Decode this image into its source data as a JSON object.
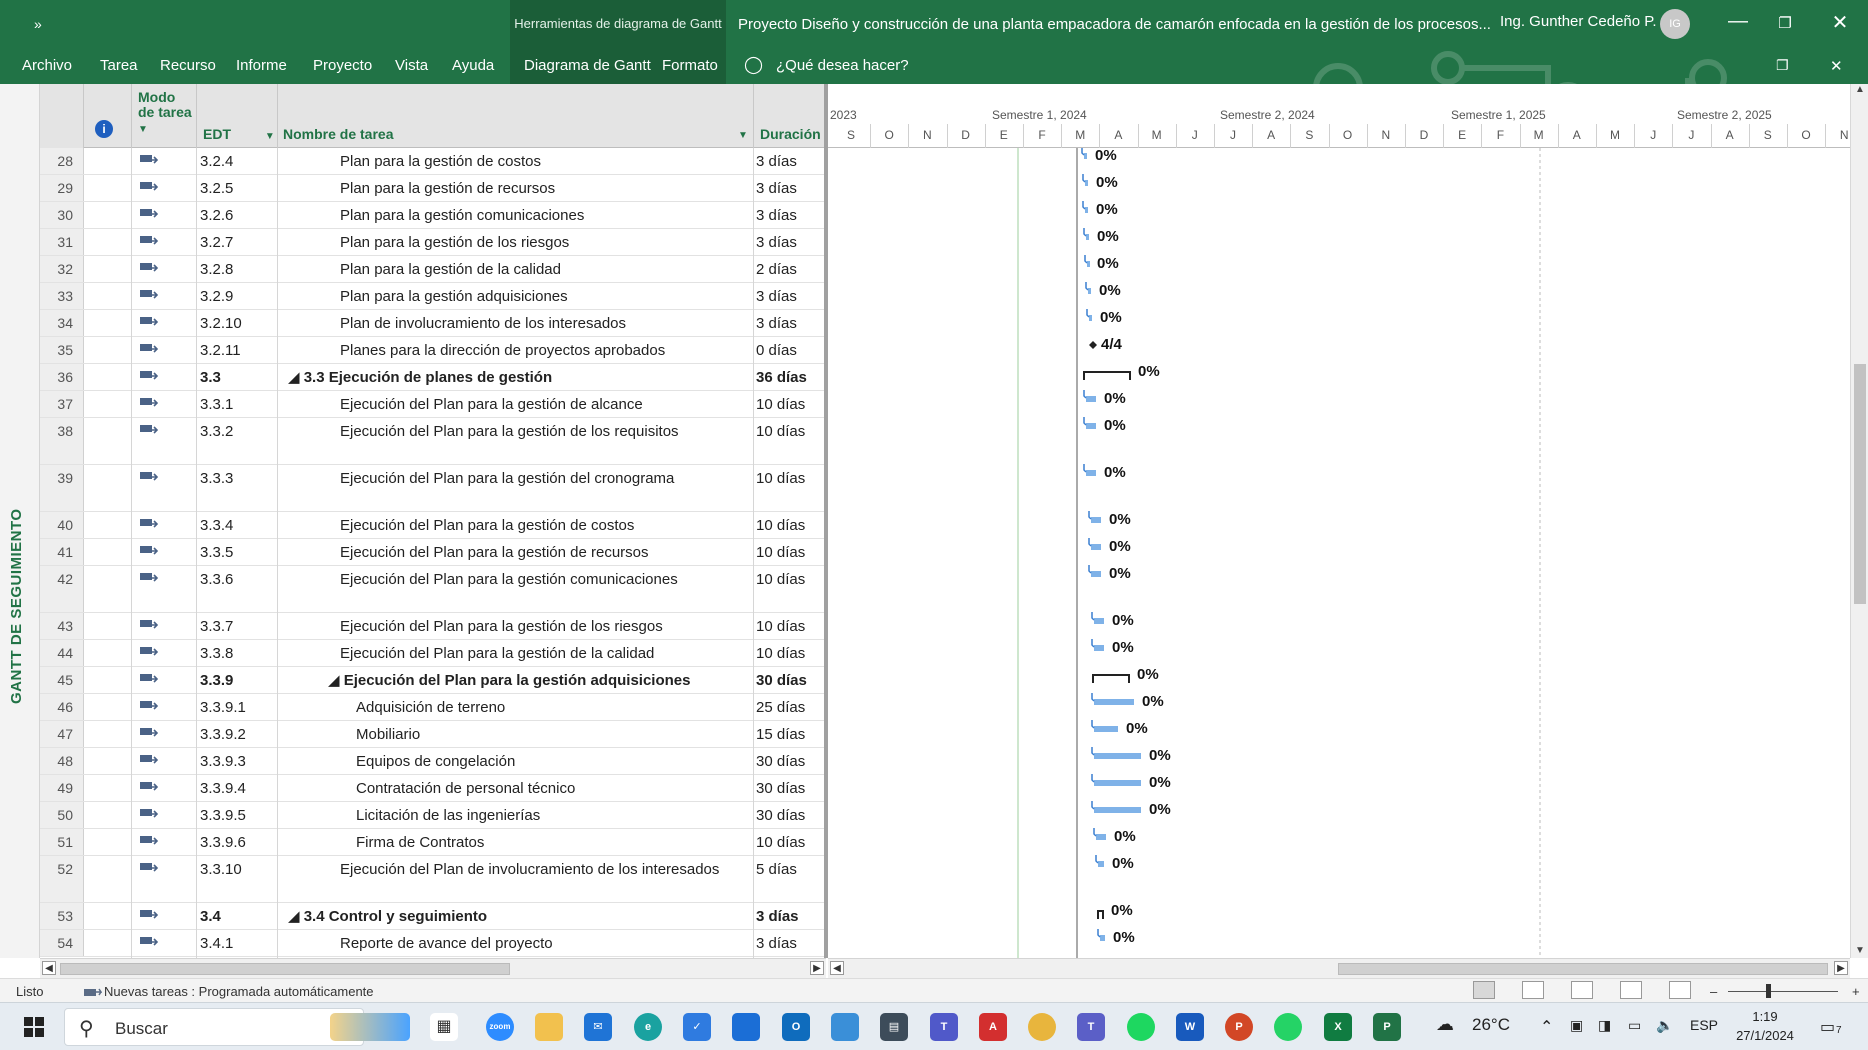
{
  "titlebar": {
    "qat": "»",
    "context_tools": "Herramientas de diagrama de Gantt",
    "doc_title": "Proyecto Diseño y construcción de una planta empacadora de camarón enfocada en la gestión de los procesos...",
    "user": "Ing. Gunther Cedeño P.",
    "avatar": "IG",
    "minimize": "—",
    "restore": "❐",
    "close": "✕"
  },
  "ribbon": {
    "tabs": [
      "Archivo",
      "Tarea",
      "Recurso",
      "Informe",
      "Proyecto",
      "Vista",
      "Ayuda",
      "Diagrama de Gantt",
      "Formato"
    ],
    "tell_me": "¿Qué desea hacer?",
    "restore": "❐",
    "close": "✕"
  },
  "sidebar": {
    "label": "GANTT DE SEGUIMIENTO"
  },
  "table": {
    "headers": {
      "info": "i",
      "modo": "Modo de tarea",
      "edt": "EDT",
      "nombre": "Nombre de tarea",
      "duracion": "Duración"
    },
    "rows": [
      {
        "n": "28",
        "edt": "3.2.4",
        "name": "Plan para la gestión de costos",
        "dur": "3 días",
        "lvl": 2,
        "bold": false,
        "h": 1,
        "pct": "0%"
      },
      {
        "n": "29",
        "edt": "3.2.5",
        "name": "Plan para la gestión de recursos",
        "dur": "3 días",
        "lvl": 2,
        "bold": false,
        "h": 1,
        "pct": "0%"
      },
      {
        "n": "30",
        "edt": "3.2.6",
        "name": "Plan para la gestión comunicaciones",
        "dur": "3 días",
        "lvl": 2,
        "bold": false,
        "h": 1,
        "pct": "0%"
      },
      {
        "n": "31",
        "edt": "3.2.7",
        "name": "Plan para la gestión de los riesgos",
        "dur": "3 días",
        "lvl": 2,
        "bold": false,
        "h": 1,
        "pct": "0%"
      },
      {
        "n": "32",
        "edt": "3.2.8",
        "name": "Plan para la gestión de la calidad",
        "dur": "2 días",
        "lvl": 2,
        "bold": false,
        "h": 1,
        "pct": "0%"
      },
      {
        "n": "33",
        "edt": "3.2.9",
        "name": "Plan para la gestión adquisiciones",
        "dur": "3 días",
        "lvl": 2,
        "bold": false,
        "h": 1,
        "pct": "0%"
      },
      {
        "n": "34",
        "edt": "3.2.10",
        "name": "Plan de involucramiento de los interesados",
        "dur": "3 días",
        "lvl": 2,
        "bold": false,
        "h": 1,
        "pct": "0%"
      },
      {
        "n": "35",
        "edt": "3.2.11",
        "name": "Planes para la dirección de proyectos aprobados",
        "dur": "0 días",
        "lvl": 2,
        "bold": false,
        "h": 1,
        "pct": "4/4"
      },
      {
        "n": "36",
        "edt": "3.3",
        "name": "◢ 3.3 Ejecución de planes de gestión",
        "dur": "36 días",
        "lvl": 1,
        "bold": true,
        "h": 1,
        "pct": "0%"
      },
      {
        "n": "37",
        "edt": "3.3.1",
        "name": "Ejecución del Plan para la gestión de alcance",
        "dur": "10 días",
        "lvl": 2,
        "bold": false,
        "h": 1,
        "pct": "0%"
      },
      {
        "n": "38",
        "edt": "3.3.2",
        "name": "Ejecución del  Plan para la gestión de los requisitos",
        "dur": "10 días",
        "lvl": 2,
        "bold": false,
        "h": 2,
        "pct": "0%"
      },
      {
        "n": "39",
        "edt": "3.3.3",
        "name": "Ejecución del Plan para la gestión del cronograma",
        "dur": "10 días",
        "lvl": 2,
        "bold": false,
        "h": 2,
        "pct": "0%"
      },
      {
        "n": "40",
        "edt": "3.3.4",
        "name": "Ejecución del Plan para la gestión de costos",
        "dur": "10 días",
        "lvl": 2,
        "bold": false,
        "h": 1,
        "pct": "0%"
      },
      {
        "n": "41",
        "edt": "3.3.5",
        "name": "Ejecución del Plan para la gestión de recursos",
        "dur": "10 días",
        "lvl": 2,
        "bold": false,
        "h": 1,
        "pct": "0%"
      },
      {
        "n": "42",
        "edt": "3.3.6",
        "name": "Ejecución del Plan para la gestión comunicaciones",
        "dur": "10 días",
        "lvl": 2,
        "bold": false,
        "h": 2,
        "pct": "0%"
      },
      {
        "n": "43",
        "edt": "3.3.7",
        "name": "Ejecución del Plan para la gestión de los riesgos",
        "dur": "10 días",
        "lvl": 2,
        "bold": false,
        "h": 1,
        "pct": "0%"
      },
      {
        "n": "44",
        "edt": "3.3.8",
        "name": "Ejecución del Plan para la gestión de la calidad",
        "dur": "10 días",
        "lvl": 2,
        "bold": false,
        "h": 1,
        "pct": "0%"
      },
      {
        "n": "45",
        "edt": "3.3.9",
        "name": "◢ Ejecución del Plan para la gestión adquisiciones",
        "dur": "30 días",
        "lvl": 1.5,
        "bold": true,
        "h": 1,
        "pct": "0%"
      },
      {
        "n": "46",
        "edt": "3.3.9.1",
        "name": "Adquisición de terreno",
        "dur": "25 días",
        "lvl": 3,
        "bold": false,
        "h": 1,
        "pct": "0%"
      },
      {
        "n": "47",
        "edt": "3.3.9.2",
        "name": "Mobiliario",
        "dur": "15 días",
        "lvl": 3,
        "bold": false,
        "h": 1,
        "pct": "0%"
      },
      {
        "n": "48",
        "edt": "3.3.9.3",
        "name": "Equipos de congelación",
        "dur": "30 días",
        "lvl": 3,
        "bold": false,
        "h": 1,
        "pct": "0%"
      },
      {
        "n": "49",
        "edt": "3.3.9.4",
        "name": "Contratación de personal técnico",
        "dur": "30 días",
        "lvl": 3,
        "bold": false,
        "h": 1,
        "pct": "0%"
      },
      {
        "n": "50",
        "edt": "3.3.9.5",
        "name": "Licitación de las ingenierías",
        "dur": "30 días",
        "lvl": 3,
        "bold": false,
        "h": 1,
        "pct": "0%"
      },
      {
        "n": "51",
        "edt": "3.3.9.6",
        "name": "Firma de Contratos",
        "dur": "10 días",
        "lvl": 3,
        "bold": false,
        "h": 1,
        "pct": "0%"
      },
      {
        "n": "52",
        "edt": "3.3.10",
        "name": "Ejecución del Plan de involucramiento de los interesados",
        "dur": "5 días",
        "lvl": 2,
        "bold": false,
        "h": 2,
        "pct": "0%"
      },
      {
        "n": "53",
        "edt": "3.4",
        "name": "◢ 3.4 Control y seguimiento",
        "dur": "3 días",
        "lvl": 1,
        "bold": true,
        "h": 1,
        "pct": "0%"
      },
      {
        "n": "54",
        "edt": "3.4.1",
        "name": "Reporte de avance del proyecto",
        "dur": "3 días",
        "lvl": 2,
        "bold": false,
        "h": 1,
        "pct": "0%"
      }
    ]
  },
  "timescale": {
    "semesters": [
      "2023",
      "Semestre 1, 2024",
      "Semestre 2, 2024",
      "Semestre 1, 2025",
      "Semestre 2, 2025"
    ],
    "months": [
      "S",
      "O",
      "N",
      "D",
      "E",
      "F",
      "M",
      "A",
      "M",
      "J",
      "J",
      "A",
      "S",
      "O",
      "N",
      "D",
      "E",
      "F",
      "M",
      "A",
      "M",
      "J",
      "J",
      "A",
      "S",
      "O",
      "N"
    ]
  },
  "status": {
    "ready": "Listo",
    "new_tasks": "Nuevas tareas : Programada automáticamente",
    "zoom_minus": "–",
    "zoom_plus": "+"
  },
  "taskbar": {
    "search": "Buscar",
    "weather": "26°C",
    "lang": "ESP",
    "time": "1:19",
    "date": "27/1/2024",
    "notif": "7"
  },
  "colors": {
    "accent": "#217346",
    "bar": "#7fb2e8",
    "bar_dark": "#3a7fd1"
  }
}
